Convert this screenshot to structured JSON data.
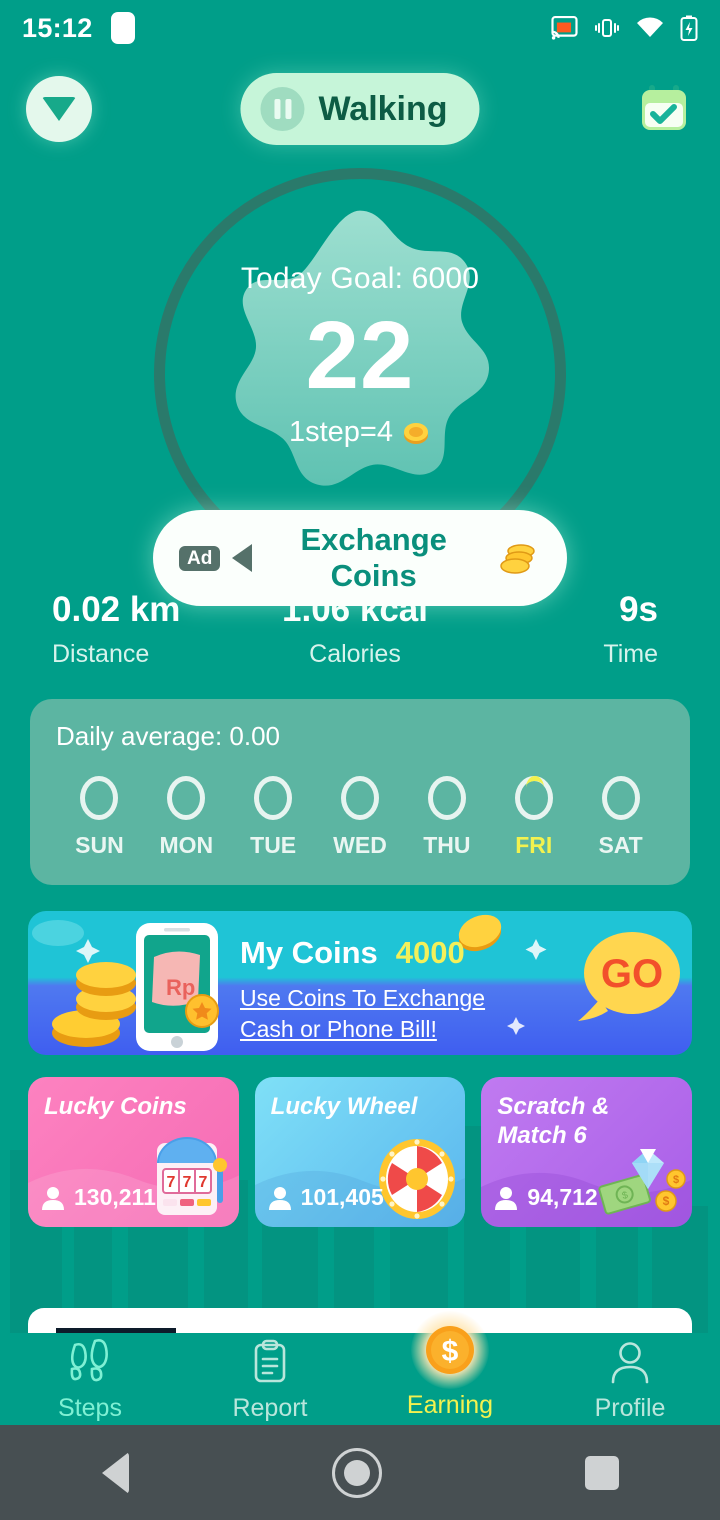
{
  "theme": {
    "bg_teal": "#009e89",
    "ring_dark": "#2a7a6b",
    "accent_yellow": "#f3f24f",
    "mint": "#c6f5d9",
    "card_panel": "#5cb5a2"
  },
  "status_bar": {
    "time": "15:12",
    "icons": [
      "cast-icon",
      "vibrate-icon",
      "wifi-icon",
      "battery-charging-icon"
    ]
  },
  "top_nav": {
    "dropdown_icon": "chevron-down-icon",
    "mode_label": "Walking",
    "pause_icon": "pause-icon",
    "calendar_icon": "calendar-check-icon"
  },
  "hero": {
    "goal_label": "Today Goal: 6000",
    "steps": "22",
    "rate_label": "1step=4",
    "rate_icon": "coin-icon"
  },
  "ad_button": {
    "badge": "Ad",
    "speaker_icon": "speaker-icon",
    "label": "Exchange Coins",
    "coins_icon": "coin-stack-icon"
  },
  "stats": [
    {
      "value": "0.02 km",
      "label": "Distance"
    },
    {
      "value": "1.06 kcal",
      "label": "Calories"
    },
    {
      "value": "9s",
      "label": "Time"
    }
  ],
  "week_panel": {
    "average_label": "Daily average: 0.00",
    "days": [
      {
        "label": "SUN",
        "active": false
      },
      {
        "label": "MON",
        "active": false
      },
      {
        "label": "TUE",
        "active": false
      },
      {
        "label": "WED",
        "active": false
      },
      {
        "label": "THU",
        "active": false
      },
      {
        "label": "FRI",
        "active": true
      },
      {
        "label": "SAT",
        "active": false
      }
    ]
  },
  "coins_banner": {
    "title": "My Coins",
    "amount": "4000",
    "subtitle": "Use Coins To Exchange Cash or Phone Bill!",
    "go_label": "GO",
    "phone_currency": "Rp",
    "phone_icon": "phone-money-icon",
    "go_icon": "speech-bubble-icon"
  },
  "games": [
    {
      "title": "Lucky Coins",
      "players": "130,211",
      "icon": "slot-machine-icon"
    },
    {
      "title": "Lucky Wheel",
      "players": "101,405",
      "icon": "fortune-wheel-icon"
    },
    {
      "title": "Scratch & Match 6",
      "players": "94,712",
      "icon": "diamond-cash-icon"
    }
  ],
  "tabs": [
    {
      "label": "Steps",
      "icon": "footprints-icon"
    },
    {
      "label": "Report",
      "icon": "clipboard-icon"
    },
    {
      "label": "Earning",
      "icon": "dollar-coin-icon"
    },
    {
      "label": "Profile",
      "icon": "person-icon"
    }
  ],
  "android_nav": {
    "back": "back-icon",
    "home": "home-icon",
    "recents": "recents-icon"
  }
}
